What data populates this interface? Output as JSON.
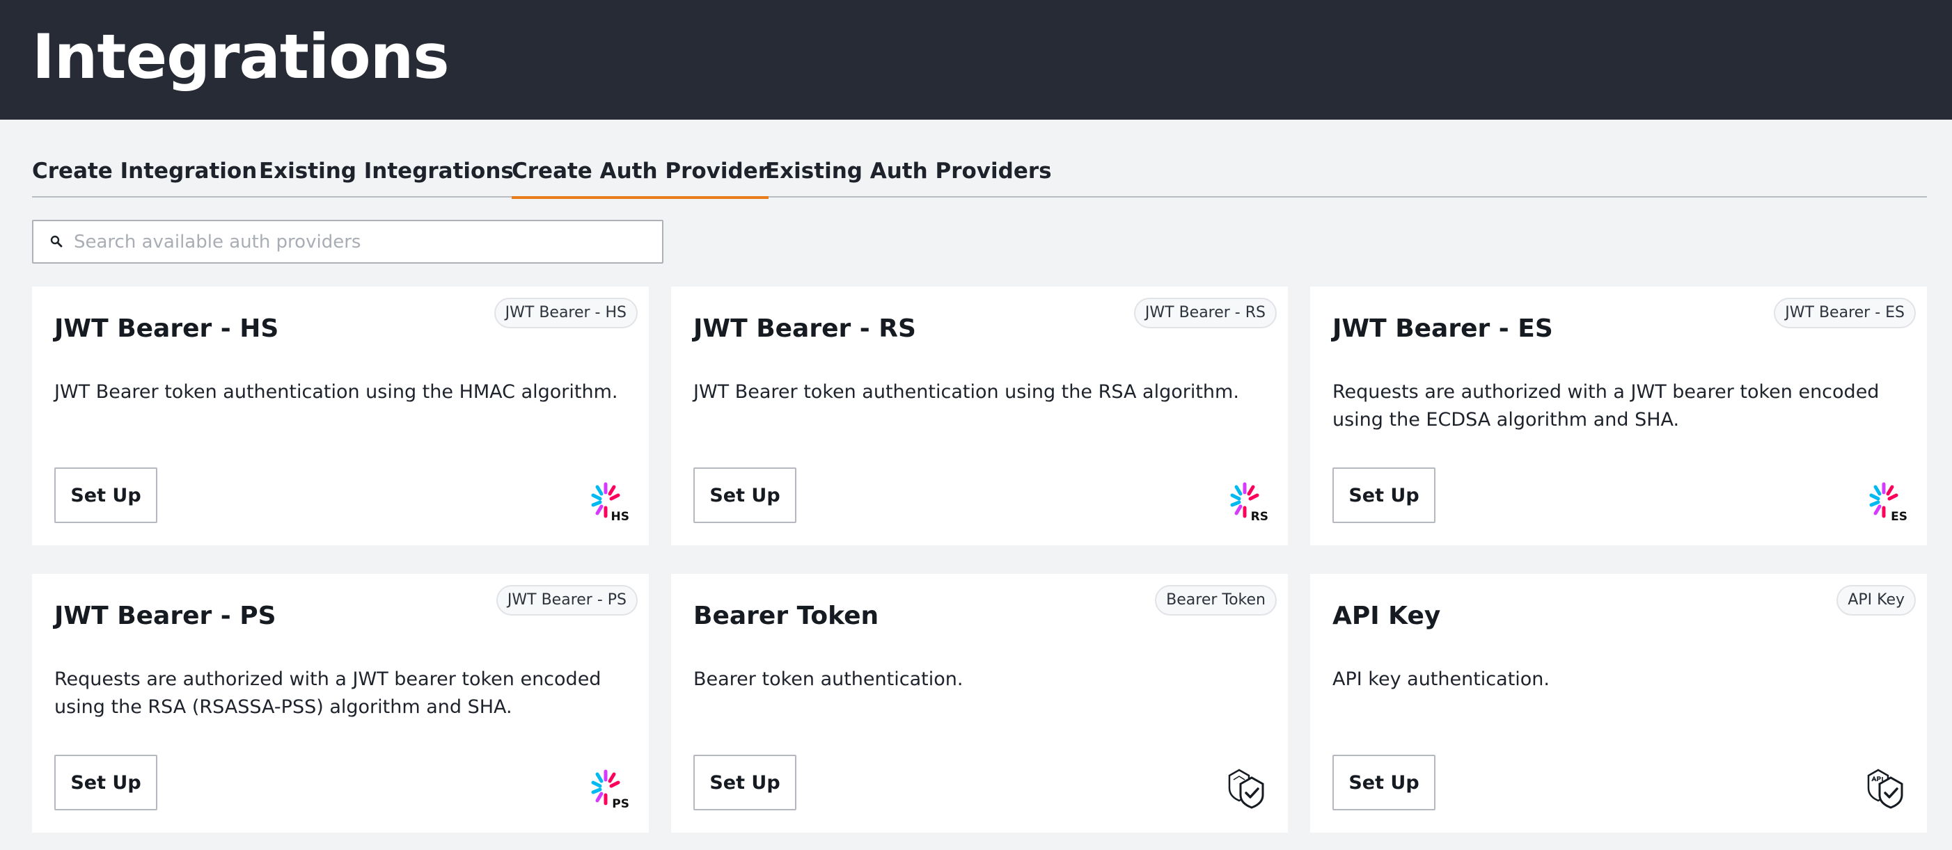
{
  "header": {
    "title": "Integrations"
  },
  "tabs": [
    {
      "label": "Create Integration",
      "active": false
    },
    {
      "label": "Existing Integrations",
      "active": false
    },
    {
      "label": "Create Auth Provider",
      "active": true
    },
    {
      "label": "Existing Auth Providers",
      "active": false
    }
  ],
  "search": {
    "placeholder": "Search available auth providers",
    "value": ""
  },
  "colors": {
    "header_bg": "#262b35",
    "accent": "#ea7b1b",
    "page_bg": "#f2f3f5"
  },
  "cards": [
    {
      "title": "JWT Bearer - HS",
      "badge": "JWT Bearer - HS",
      "description": "JWT Bearer token authentication using the HMAC algorithm.",
      "button": "Set Up",
      "icon": "jwt-logo-icon",
      "icon_tag": "HS"
    },
    {
      "title": "JWT Bearer - RS",
      "badge": "JWT Bearer - RS",
      "description": "JWT Bearer token authentication using the RSA algorithm.",
      "button": "Set Up",
      "icon": "jwt-logo-icon",
      "icon_tag": "RS"
    },
    {
      "title": "JWT Bearer - ES",
      "badge": "JWT Bearer - ES",
      "description": "Requests are authorized with a JWT bearer token encoded using the ECDSA algorithm and SHA.",
      "button": "Set Up",
      "icon": "jwt-logo-icon",
      "icon_tag": "ES"
    },
    {
      "title": "JWT Bearer - PS",
      "badge": "JWT Bearer - PS",
      "description": "Requests are authorized with a JWT bearer token encoded using the RSA (RSASSA-PSS) algorithm and SHA.",
      "button": "Set Up",
      "icon": "jwt-logo-icon",
      "icon_tag": "PS"
    },
    {
      "title": "Bearer Token",
      "badge": "Bearer Token",
      "description": "Bearer token authentication.",
      "button": "Set Up",
      "icon": "bearer-shield-icon"
    },
    {
      "title": "API Key",
      "badge": "API Key",
      "description": "API key authentication.",
      "button": "Set Up",
      "icon": "api-key-shield-icon"
    }
  ]
}
